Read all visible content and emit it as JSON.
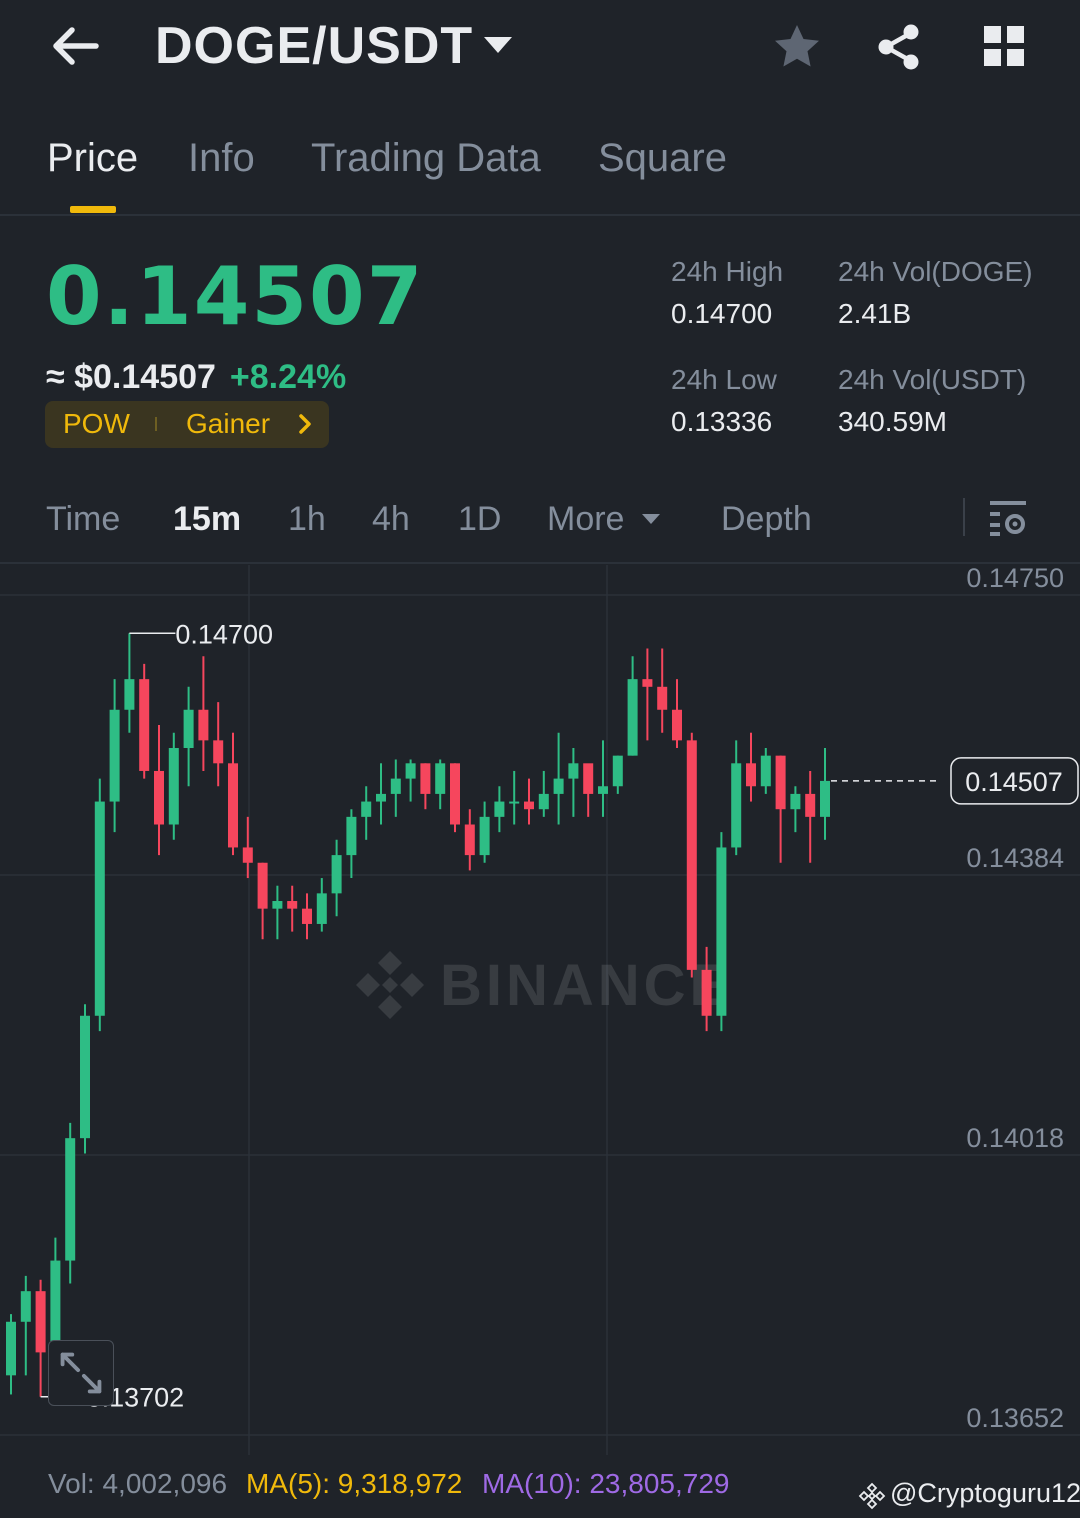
{
  "header": {
    "pair": "DOGE/USDT",
    "icons": [
      "back-arrow-icon",
      "caret-down-icon",
      "star-icon",
      "share-icon",
      "grid-icon"
    ]
  },
  "tabs": [
    {
      "label": "Price",
      "active": true
    },
    {
      "label": "Info",
      "active": false
    },
    {
      "label": "Trading Data",
      "active": false
    },
    {
      "label": "Square",
      "active": false
    }
  ],
  "ticker": {
    "last_price": "0.14507",
    "fiat_price": "≈ $0.14507",
    "change_pct": "+8.24%",
    "tags": [
      "POW",
      "Gainer"
    ]
  },
  "stats": {
    "high_label": "24h High",
    "high_value": "0.14700",
    "low_label": "24h Low",
    "low_value": "0.13336",
    "vol_base_label": "24h Vol(DOGE)",
    "vol_base_value": "2.41B",
    "vol_quote_label": "24h Vol(USDT)",
    "vol_quote_value": "340.59M"
  },
  "intervals": {
    "items": [
      "Time",
      "15m",
      "1h",
      "4h",
      "1D",
      "More",
      "Depth"
    ],
    "active": "15m"
  },
  "chart_data": {
    "type": "candlestick",
    "ylim": [
      0.13652,
      0.1475
    ],
    "y_ticks": [
      "0.14750",
      "0.14384",
      "0.14018",
      "0.13652"
    ],
    "last_price_label": "0.14507",
    "last_price": 0.14507,
    "high_marker": {
      "label": "0.14700",
      "value": 0.147
    },
    "low_marker": {
      "label": "0.13702",
      "value": 0.13702
    },
    "watermark": "BINANCE",
    "colors": {
      "up": "#2ebd85",
      "down": "#f6465d",
      "grid": "#2b3139",
      "axis_text": "#848e9c"
    },
    "candles": [
      [
        0.1373,
        0.138,
        0.13705,
        0.1381
      ],
      [
        0.138,
        0.1384,
        0.1373,
        0.1386
      ],
      [
        0.1384,
        0.1376,
        0.13702,
        0.13855
      ],
      [
        0.1376,
        0.1388,
        0.1374,
        0.1391
      ],
      [
        0.1388,
        0.1404,
        0.1385,
        0.1406
      ],
      [
        0.1404,
        0.142,
        0.1402,
        0.14215
      ],
      [
        0.142,
        0.1448,
        0.1418,
        0.1451
      ],
      [
        0.1448,
        0.146,
        0.1444,
        0.1464
      ],
      [
        0.146,
        0.1464,
        0.1457,
        0.147
      ],
      [
        0.1464,
        0.1452,
        0.1451,
        0.1466
      ],
      [
        0.1452,
        0.1445,
        0.1441,
        0.1458
      ],
      [
        0.1445,
        0.1455,
        0.1443,
        0.1457
      ],
      [
        0.1455,
        0.146,
        0.145,
        0.1463
      ],
      [
        0.146,
        0.1456,
        0.1452,
        0.1467
      ],
      [
        0.1456,
        0.1453,
        0.145,
        0.1461
      ],
      [
        0.1453,
        0.1442,
        0.1441,
        0.1457
      ],
      [
        0.1442,
        0.144,
        0.1438,
        0.1446
      ],
      [
        0.144,
        0.1434,
        0.143,
        0.144
      ],
      [
        0.1434,
        0.1435,
        0.143,
        0.1437
      ],
      [
        0.1435,
        0.1434,
        0.1431,
        0.1437
      ],
      [
        0.1434,
        0.1432,
        0.143,
        0.1436
      ],
      [
        0.1432,
        0.1436,
        0.1431,
        0.1438
      ],
      [
        0.1436,
        0.1441,
        0.1433,
        0.1443
      ],
      [
        0.1441,
        0.1446,
        0.1438,
        0.1447
      ],
      [
        0.1446,
        0.1448,
        0.1443,
        0.145
      ],
      [
        0.1448,
        0.1449,
        0.1445,
        0.1453
      ],
      [
        0.1449,
        0.1451,
        0.1446,
        0.14535
      ],
      [
        0.1451,
        0.1453,
        0.1448,
        0.14535
      ],
      [
        0.1453,
        0.1449,
        0.1447,
        0.1453
      ],
      [
        0.1449,
        0.1453,
        0.1447,
        0.14535
      ],
      [
        0.1453,
        0.1445,
        0.1444,
        0.1453
      ],
      [
        0.1445,
        0.1441,
        0.1439,
        0.1447
      ],
      [
        0.1441,
        0.1446,
        0.144,
        0.1448
      ],
      [
        0.1446,
        0.1448,
        0.1444,
        0.145
      ],
      [
        0.1448,
        0.1448,
        0.1445,
        0.1452
      ],
      [
        0.1448,
        0.1447,
        0.1445,
        0.1451
      ],
      [
        0.1447,
        0.1449,
        0.1446,
        0.1452
      ],
      [
        0.1449,
        0.1451,
        0.1445,
        0.1457
      ],
      [
        0.1451,
        0.1453,
        0.1446,
        0.1455
      ],
      [
        0.1453,
        0.1449,
        0.1446,
        0.1452
      ],
      [
        0.1449,
        0.145,
        0.1446,
        0.1456
      ],
      [
        0.145,
        0.1454,
        0.1449,
        0.1454
      ],
      [
        0.1454,
        0.1464,
        0.1454,
        0.1467
      ],
      [
        0.1464,
        0.1463,
        0.1456,
        0.1468
      ],
      [
        0.1463,
        0.146,
        0.1457,
        0.1468
      ],
      [
        0.146,
        0.1456,
        0.1455,
        0.1464
      ],
      [
        0.1456,
        0.1426,
        0.1425,
        0.1457
      ],
      [
        0.1426,
        0.142,
        0.1418,
        0.1429
      ],
      [
        0.142,
        0.1442,
        0.1418,
        0.1444
      ],
      [
        0.1442,
        0.1453,
        0.1441,
        0.1456
      ],
      [
        0.1453,
        0.145,
        0.1448,
        0.1457
      ],
      [
        0.145,
        0.1454,
        0.1449,
        0.1455
      ],
      [
        0.1454,
        0.1447,
        0.144,
        0.1454
      ],
      [
        0.1447,
        0.1449,
        0.1444,
        0.145
      ],
      [
        0.1449,
        0.1446,
        0.144,
        0.1452
      ],
      [
        0.1446,
        0.14507,
        0.1443,
        0.1455
      ]
    ]
  },
  "footer": {
    "vol": "Vol: 4,002,096",
    "ma5": "MA(5): 9,318,972",
    "ma10": "MA(10): 23,805,729",
    "credit": "@Cryptoguru12"
  }
}
